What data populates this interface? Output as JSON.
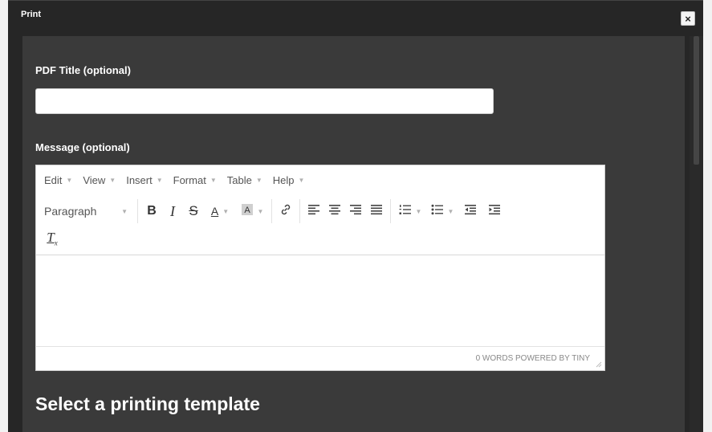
{
  "dialog": {
    "title": "Print",
    "close_label": "×"
  },
  "pdf_title": {
    "label": "PDF Title (optional)",
    "value": "",
    "placeholder": ""
  },
  "message": {
    "label": "Message (optional)"
  },
  "editor": {
    "menus": [
      {
        "label": "Edit"
      },
      {
        "label": "View"
      },
      {
        "label": "Insert"
      },
      {
        "label": "Format"
      },
      {
        "label": "Table"
      },
      {
        "label": "Help"
      }
    ],
    "block_format": "Paragraph",
    "toolbar_icons": [
      "bold-icon",
      "italic-icon",
      "strikethrough-icon",
      "text-color-icon",
      "background-color-icon",
      "link-icon",
      "align-left-icon",
      "align-center-icon",
      "align-right-icon",
      "justify-icon",
      "numbered-list-icon",
      "bullet-list-icon",
      "outdent-icon",
      "indent-icon",
      "clear-formatting-icon"
    ],
    "status": "0 WORDS POWERED BY TINY"
  },
  "templates": {
    "heading": "Select a printing template"
  },
  "colors": {
    "dialog_bg": "#262626",
    "panel_bg": "#3a3a3a",
    "editor_bg": "#ffffff"
  }
}
